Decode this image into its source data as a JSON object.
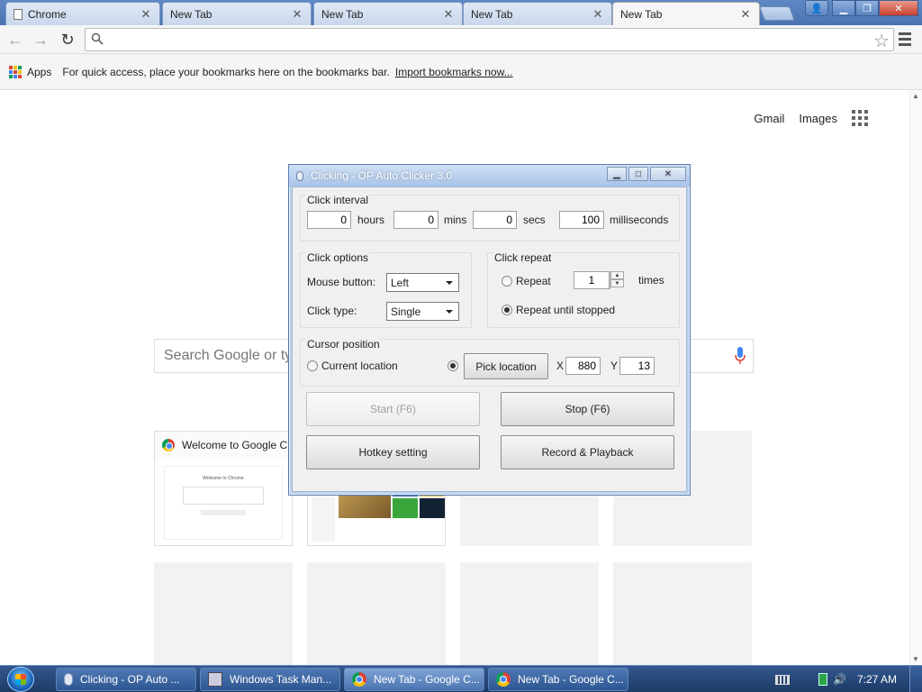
{
  "browser": {
    "tabs": [
      {
        "label": "Chrome"
      },
      {
        "label": "New Tab"
      },
      {
        "label": "New Tab"
      },
      {
        "label": "New Tab"
      },
      {
        "label": "New Tab"
      }
    ],
    "bookmarks": {
      "apps_label": "Apps",
      "hint": "For quick access, place your bookmarks here on the bookmarks bar.",
      "import_label": "Import bookmarks now..."
    },
    "page": {
      "gmail": "Gmail",
      "images": "Images",
      "search_placeholder": "Search Google or ty",
      "tile_title": "Welcome to Google C",
      "mini_page_heading": "Welcome to Chrome"
    }
  },
  "dialog": {
    "title": "Clicking - OP Auto Clicker 3.0",
    "interval": {
      "label": "Click interval",
      "hours": "0",
      "hours_label": "hours",
      "mins": "0",
      "mins_label": "mins",
      "secs": "0",
      "secs_label": "secs",
      "ms": "100",
      "ms_label": "milliseconds"
    },
    "options": {
      "label": "Click options",
      "mouse_button_label": "Mouse button:",
      "mouse_button": "Left",
      "click_type_label": "Click type:",
      "click_type": "Single"
    },
    "repeat": {
      "label": "Click repeat",
      "repeat_label": "Repeat",
      "repeat_count": "1",
      "times_label": "times",
      "until_stopped_label": "Repeat until stopped"
    },
    "cursor": {
      "label": "Cursor position",
      "current_label": "Current location",
      "pick_label": "Pick location",
      "x_label": "X",
      "x": "880",
      "y_label": "Y",
      "y": "13"
    },
    "buttons": {
      "start": "Start (F6)",
      "stop": "Stop (F6)",
      "hotkey": "Hotkey setting",
      "record": "Record & Playback"
    }
  },
  "taskbar": {
    "items": [
      {
        "label": "Clicking - OP Auto ..."
      },
      {
        "label": "Windows Task Man..."
      },
      {
        "label": "New Tab - Google C..."
      },
      {
        "label": "New Tab - Google C..."
      }
    ],
    "clock": "7:27 AM"
  }
}
